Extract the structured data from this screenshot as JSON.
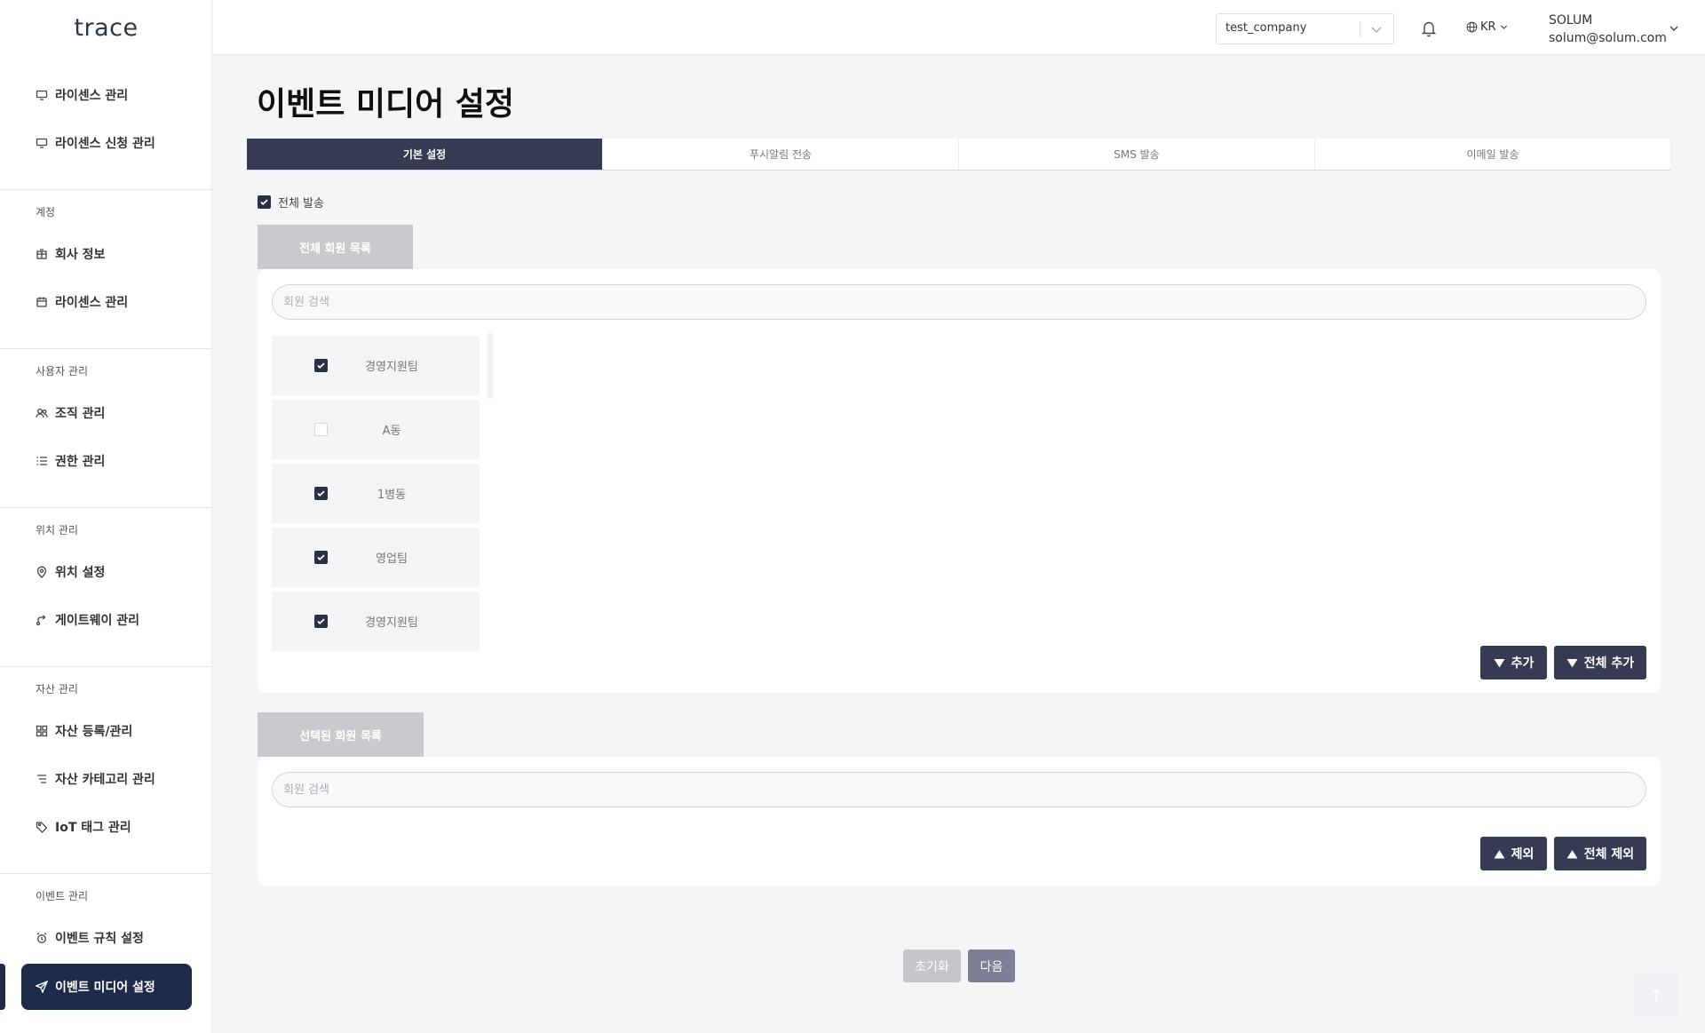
{
  "app": {
    "logo": "trace"
  },
  "sidebar": {
    "items_top": [
      {
        "label": "라이센스 관리",
        "icon": "license-icon"
      },
      {
        "label": "라이센스 신청 관리",
        "icon": "license-request-icon"
      }
    ],
    "groups": [
      {
        "label": "계정",
        "items": [
          {
            "label": "회사 정보",
            "icon": "company-icon"
          },
          {
            "label": "라이센스 관리",
            "icon": "calendar-icon"
          }
        ]
      },
      {
        "label": "사용자 관리",
        "items": [
          {
            "label": "조직 관리",
            "icon": "users-icon"
          },
          {
            "label": "권한 관리",
            "icon": "list-icon"
          }
        ]
      },
      {
        "label": "위치 관리",
        "items": [
          {
            "label": "위치 설정",
            "icon": "location-icon"
          },
          {
            "label": "게이트웨이 관리",
            "icon": "gateway-icon"
          }
        ]
      },
      {
        "label": "자산 관리",
        "items": [
          {
            "label": "자산 등록/관리",
            "icon": "grid-icon"
          },
          {
            "label": "자산 카테고리 관리",
            "icon": "category-icon"
          },
          {
            "label": "IoT 태그 관리",
            "icon": "tag-icon"
          }
        ]
      },
      {
        "label": "이벤트 관리",
        "items": [
          {
            "label": "이벤트 규칙 설정",
            "icon": "alarm-icon"
          },
          {
            "label": "이벤트 미디어 설정",
            "icon": "send-icon",
            "active": true
          }
        ]
      }
    ]
  },
  "header": {
    "company": "test_company",
    "language": "KR",
    "user_name": "SOLUM",
    "user_email": "solum@solum.com"
  },
  "page": {
    "title": "이벤트 미디어 설정",
    "tabs": [
      {
        "label": "기본 설정",
        "active": true
      },
      {
        "label": "푸시알림 전송"
      },
      {
        "label": "SMS 발송"
      },
      {
        "label": "이메일 발송"
      }
    ],
    "all_send_label": "전체 발송",
    "all_send_checked": true,
    "all_members": {
      "title": "전체 회원 목록",
      "search_placeholder": "회원 검색",
      "members": [
        {
          "name": "경영지원팀",
          "checked": true
        },
        {
          "name": "A동",
          "checked": false
        },
        {
          "name": "1병동",
          "checked": true
        },
        {
          "name": "영업팀",
          "checked": true
        },
        {
          "name": "경영지원팀",
          "checked": true
        }
      ],
      "add_label": "추가",
      "add_all_label": "전체 추가"
    },
    "selected_members": {
      "title": "선택된 회원 목록",
      "search_placeholder": "회원 검색",
      "remove_label": "제외",
      "remove_all_label": "전체 제외"
    },
    "reset_label": "초기화",
    "next_label": "다음"
  }
}
